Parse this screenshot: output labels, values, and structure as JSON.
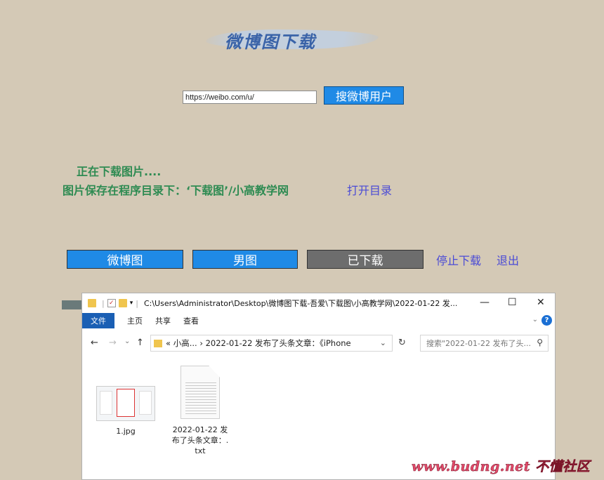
{
  "app": {
    "title": "微博图下载",
    "url_input_value": "https://weibo.com/u/",
    "search_button": "搜微博用户",
    "status_downloading": "正在下载图片....",
    "status_saved": "图片保存在程序目录下：‘下载图’/小高教学网",
    "open_dir_link": "打开目录",
    "btn_weibo_images": "微博图",
    "btn_male_images": "男图",
    "btn_downloaded": "已下载",
    "link_stop": "停止下载",
    "link_exit": "退出",
    "colors": {
      "background": "#d4c9b6",
      "button_blue": "#1f8ae6",
      "status_green": "#2e8b52",
      "link_blue": "#4a4ad6",
      "button_gray": "#6d6d6d"
    }
  },
  "explorer": {
    "title_path": "C:\\Users\\Administrator\\Desktop\\微博图下载-吾爱\\下载图\\小高教学网\\2022-01-22 发...",
    "controls": {
      "minimize": "—",
      "maximize": "☐",
      "close": "✕"
    },
    "ribbon": {
      "file": "文件",
      "tabs": [
        "主页",
        "共享",
        "查看"
      ],
      "help": "?"
    },
    "nav": {
      "back": "←",
      "forward": "→",
      "recent": "⌄",
      "up": "↑"
    },
    "address": "« 小高... › 2022-01-22 发布了头条文章：《iPhone",
    "search_placeholder": "搜索\"2022-01-22 发布了头...",
    "files": [
      {
        "name": "1.jpg",
        "icon": "image-thumbnail"
      },
      {
        "name": "2022-01-22 发布了头条文章：.txt",
        "icon": "text-file-icon"
      }
    ]
  },
  "watermark": "www.budng.net 不懂社区"
}
